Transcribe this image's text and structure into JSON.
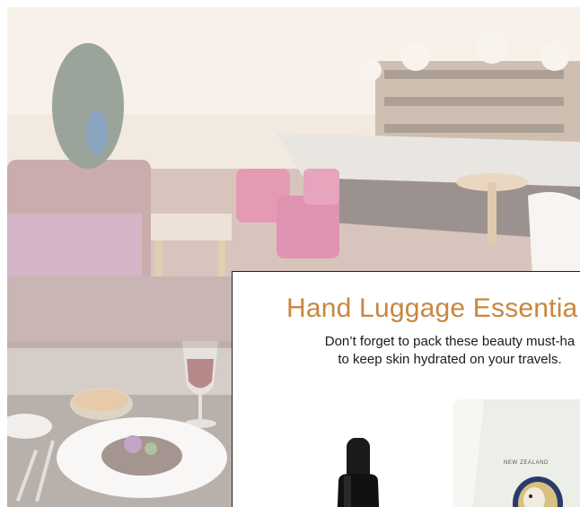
{
  "card": {
    "title": "Hand Luggage Essentia",
    "subtitle_line1": "Don’t forget to pack these beauty must-ha",
    "subtitle_line2": "to keep skin hydrated on your travels."
  },
  "tube": {
    "label": "NEW ZEALAND"
  },
  "colors": {
    "accent": "#c9863e",
    "text": "#1a1a1a",
    "border": "#222222"
  }
}
